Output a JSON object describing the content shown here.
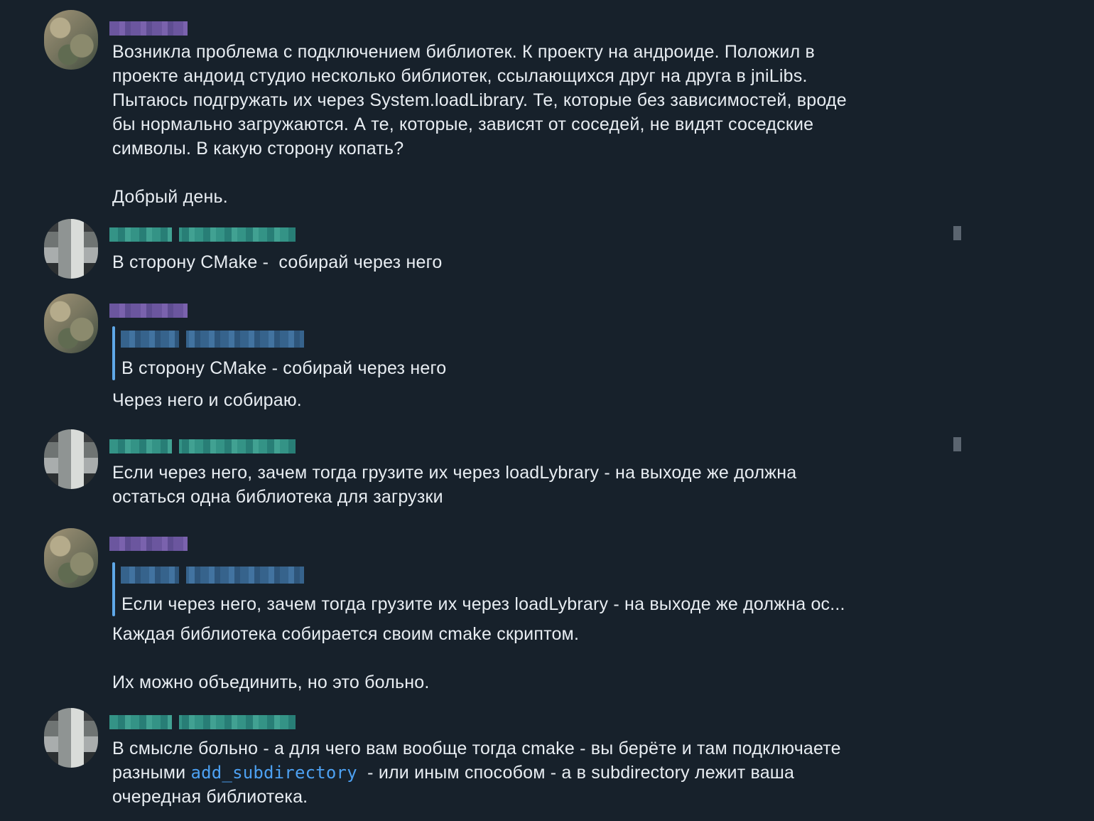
{
  "messages": [
    {
      "text": "Возникла проблема с подключением библиотек. К проекту на андроиде. Положил в\nпроекте андоид студио несколько библиотек, ссылающихся друг на друга в jniLibs.\nПытаюсь подгружать их через System.loadLibrary. Те, которые без зависимостей, вроде\nбы нормально загружаются. А те, которые, зависят от соседей, не видят соседские\nсимволы. В какую сторону копать?\n\nДобрый день."
    },
    {
      "text": "В сторону CMake -  собирай через него"
    },
    {
      "reply_text": "В сторону CMake -  собирай через него",
      "text": "Через него и собираю."
    },
    {
      "text": "Если через него, зачем тогда грузите их через loadLybrary - на выходе же должна\nостаться одна библиотека для загрузки"
    },
    {
      "reply_text": "Если через него, зачем тогда грузите их через loadLybrary - на выходе же должна ос...",
      "text": "Каждая библиотека собирается своим cmake скриптом.\n\nИх можно объединить, но это больно."
    },
    {
      "text_before": "В смысле больно - а для чего вам вообще тогда cmake - вы берёте и там подключаете\nразными ",
      "code": "add_subdirectory",
      "text_after": "  - или иным способом - а в subdirectory лежит ваша\nочередная библиотека."
    }
  ],
  "colors": {
    "background": "#17212b",
    "text": "#e8edf2",
    "reply_bar": "#5fa8e8",
    "code": "#4da1f2"
  }
}
